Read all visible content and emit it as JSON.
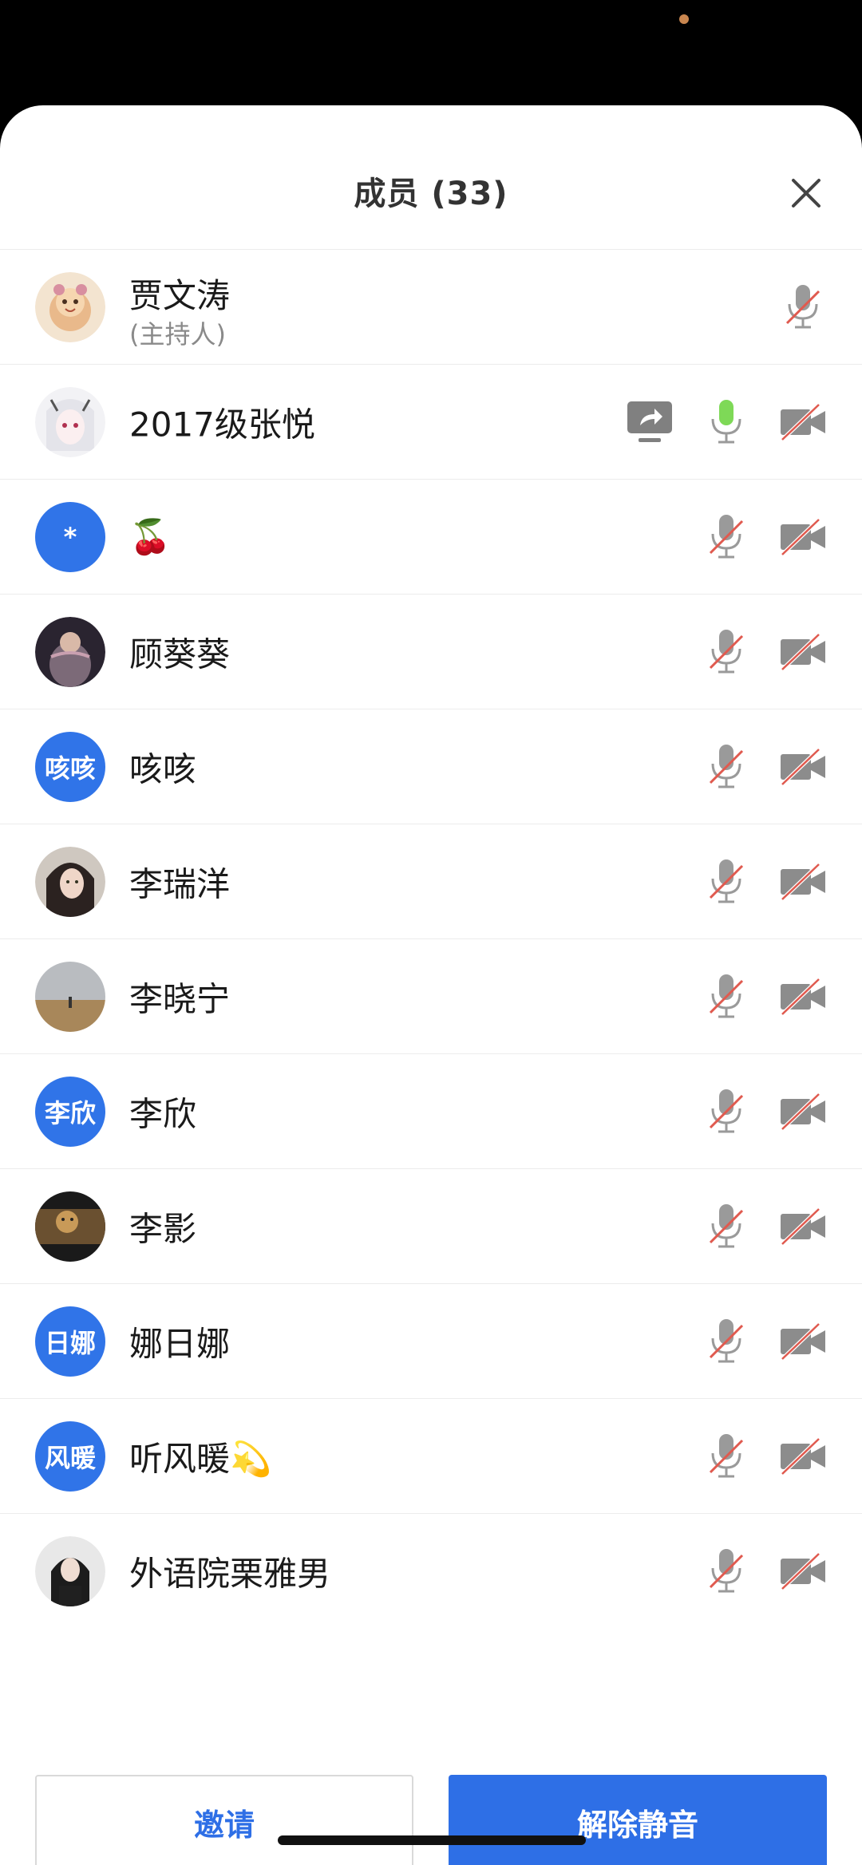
{
  "header": {
    "title": "成员 (33)"
  },
  "members": [
    {
      "name": "贾文涛",
      "role": "(主持人)",
      "avatar_type": "photo",
      "avatar_icon": "cartoon-avatar",
      "mic": "muted",
      "camera": null,
      "sharing": false
    },
    {
      "name": "2017级张悦",
      "avatar_type": "photo",
      "avatar_icon": "anime-avatar",
      "mic": "active",
      "camera": "off",
      "sharing": true
    },
    {
      "name": "🍒",
      "avatar_type": "initials",
      "initials": "*",
      "mic": "muted",
      "camera": "off",
      "sharing": false
    },
    {
      "name": "顾葵葵",
      "avatar_type": "photo",
      "avatar_icon": "photo-avatar",
      "mic": "muted",
      "camera": "off",
      "sharing": false
    },
    {
      "name": "咳咳",
      "avatar_type": "initials",
      "initials": "咳咳",
      "mic": "muted",
      "camera": "off",
      "sharing": false
    },
    {
      "name": "李瑞洋",
      "avatar_type": "photo",
      "avatar_icon": "portrait-avatar",
      "mic": "muted",
      "camera": "off",
      "sharing": false
    },
    {
      "name": "李晓宁",
      "avatar_type": "photo",
      "avatar_icon": "landscape-avatar",
      "mic": "muted",
      "camera": "off",
      "sharing": false
    },
    {
      "name": "李欣",
      "avatar_type": "initials",
      "initials": "李欣",
      "mic": "muted",
      "camera": "off",
      "sharing": false
    },
    {
      "name": "李影",
      "avatar_type": "photo",
      "avatar_icon": "movie-avatar",
      "mic": "muted",
      "camera": "off",
      "sharing": false
    },
    {
      "name": "娜日娜",
      "avatar_type": "initials",
      "initials": "日娜",
      "mic": "muted",
      "camera": "off",
      "sharing": false
    },
    {
      "name": "听风暖💫",
      "avatar_type": "initials",
      "initials": "风暖",
      "mic": "muted",
      "camera": "off",
      "sharing": false
    },
    {
      "name": "外语院栗雅男",
      "avatar_type": "photo",
      "avatar_icon": "portrait-avatar",
      "mic": "muted",
      "camera": "off",
      "sharing": false
    }
  ],
  "footer": {
    "invite_label": "邀请",
    "unmute_label": "解除静音"
  },
  "colors": {
    "accent": "#2e6fe6",
    "avatar_blue": "#3074e8",
    "mic_active": "#7ed957",
    "muted_slash": "#e05a4f",
    "icon_gray": "#9a9a9a"
  }
}
